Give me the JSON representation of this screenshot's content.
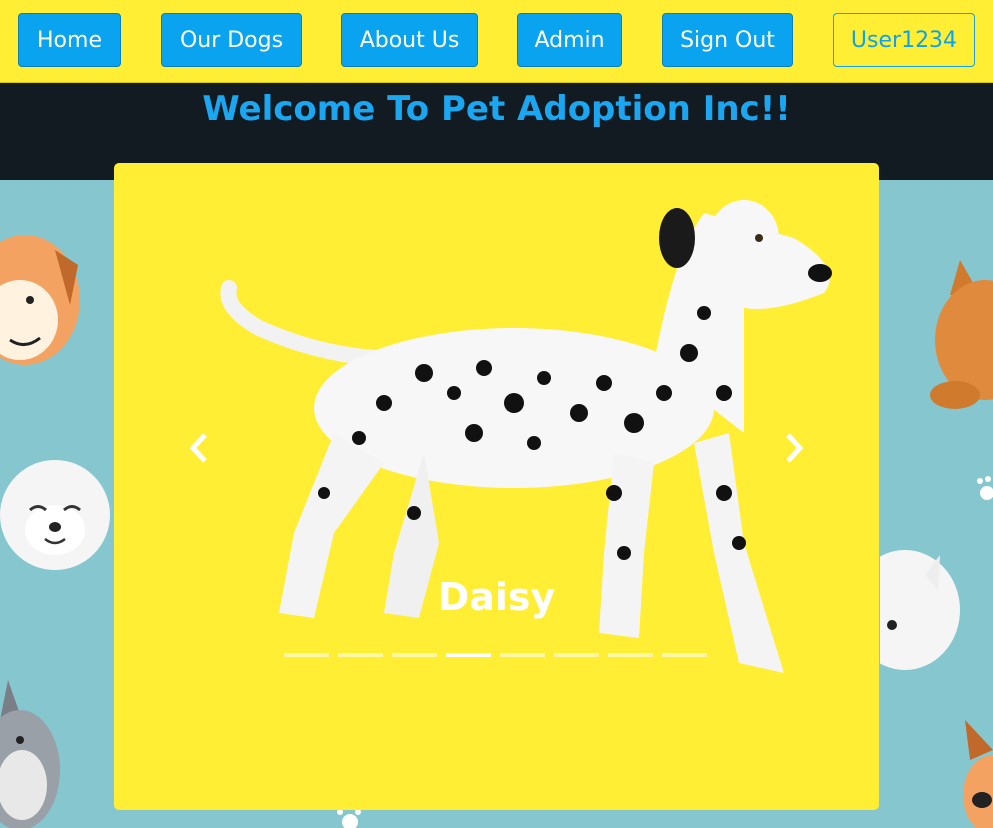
{
  "nav": {
    "buttons": [
      {
        "label": "Home"
      },
      {
        "label": "Our Dogs"
      },
      {
        "label": "About Us"
      },
      {
        "label": "Admin"
      },
      {
        "label": "Sign Out"
      }
    ],
    "user": "User1234"
  },
  "header": {
    "title": "Welcome To Pet Adoption Inc!!"
  },
  "carousel": {
    "caption": "Daisy",
    "slide_count": 8,
    "active_index": 3,
    "prev_icon": "chevron-left-icon",
    "next_icon": "chevron-right-icon"
  },
  "colors": {
    "accent": "#0aa3f0",
    "nav_bg": "#ffee33",
    "header_bg": "#121a22",
    "page_bg": "#86c7cf"
  }
}
